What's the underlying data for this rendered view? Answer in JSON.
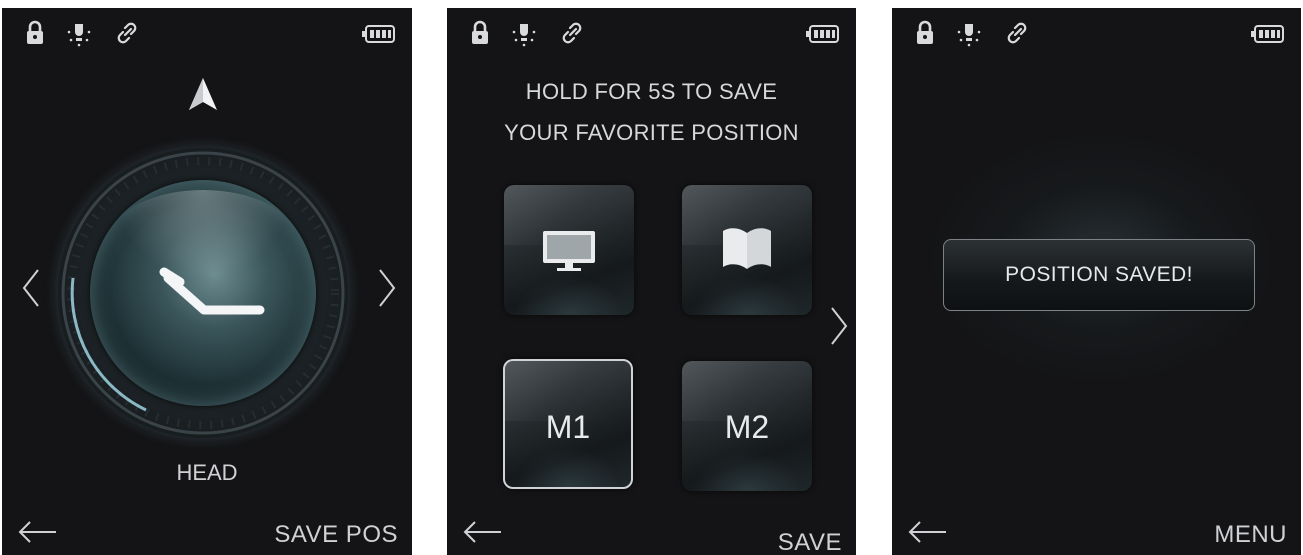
{
  "screens": [
    {
      "id": "head-adjust",
      "status_icons": [
        "lock-icon",
        "bulb-icon",
        "link-icon",
        "battery-icon"
      ],
      "dial_label": "HEAD",
      "action_label": "SAVE POS"
    },
    {
      "id": "save-favorite",
      "status_icons": [
        "lock-icon",
        "bulb-icon",
        "link-icon",
        "battery-icon"
      ],
      "instruction_line1": "HOLD FOR 5S TO SAVE",
      "instruction_line2": "YOUR FAVORITE POSITION",
      "tiles": [
        {
          "id": "tv",
          "icon": "tv-icon",
          "label": ""
        },
        {
          "id": "read",
          "icon": "book-icon",
          "label": ""
        },
        {
          "id": "m1",
          "label": "M1",
          "selected": true
        },
        {
          "id": "m2",
          "label": "M2",
          "selected": false
        }
      ],
      "action_label": "SAVE"
    },
    {
      "id": "saved-confirmation",
      "status_icons": [
        "lock-icon",
        "bulb-icon",
        "link-icon",
        "battery-icon"
      ],
      "toast": "POSITION SAVED!",
      "action_label": "MENU"
    }
  ],
  "colors": {
    "screen_bg": "#141416",
    "text": "#cfd1d4",
    "accent_teal": "#5e8b92"
  }
}
